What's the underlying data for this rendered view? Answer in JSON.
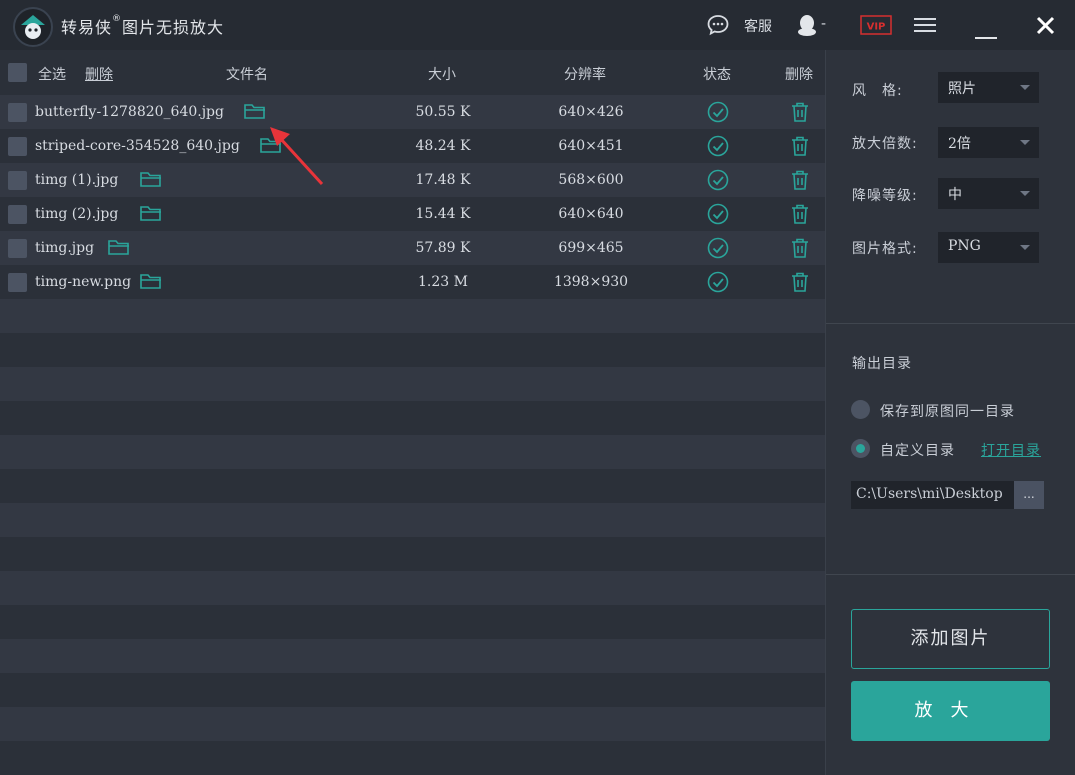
{
  "titlebar": {
    "app_name": "转易侠",
    "trademark": "®",
    "subtitle": "图片无损放大",
    "service_label": "客服",
    "qq_status": "-",
    "vip_label": "VIP"
  },
  "list": {
    "select_all_label": "全选",
    "delete_label": "删除",
    "columns": {
      "filename": "文件名",
      "size": "大小",
      "resolution": "分辨率",
      "status": "状态",
      "delete": "删除"
    },
    "rows": [
      {
        "filename": "butterfly-1278820_640.jpg",
        "size": "50.55 K",
        "resolution": "640×426"
      },
      {
        "filename": "striped-core-354528_640.jpg",
        "size": "48.24 K",
        "resolution": "640×451"
      },
      {
        "filename": "timg (1).jpg",
        "size": "17.48 K",
        "resolution": "568×600"
      },
      {
        "filename": "timg (2).jpg",
        "size": "15.44 K",
        "resolution": "640×640"
      },
      {
        "filename": "timg.jpg",
        "size": "57.89 K",
        "resolution": "699×465"
      },
      {
        "filename": "timg-new.png",
        "size": "1.23 M",
        "resolution": "1398×930"
      }
    ]
  },
  "options": {
    "style_label": "风　格:",
    "style_value": "照片",
    "scale_label": "放大倍数:",
    "scale_value": "2倍",
    "denoise_label": "降噪等级:",
    "denoise_value": "中",
    "format_label": "图片格式:",
    "format_value": "PNG"
  },
  "output": {
    "heading": "输出目录",
    "same_dir_label": "保存到原图同一目录",
    "custom_dir_label": "自定义目录",
    "open_dir_link": "打开目录",
    "path": "C:\\Users\\mi\\Desktop",
    "browse_label": "..."
  },
  "actions": {
    "add_label": "添加图片",
    "enlarge_label": "放大"
  },
  "colors": {
    "accent": "#2aa59b",
    "delete_icon": "#2aa59b",
    "arrow": "#e8343a",
    "vip": "#d62f2f"
  }
}
